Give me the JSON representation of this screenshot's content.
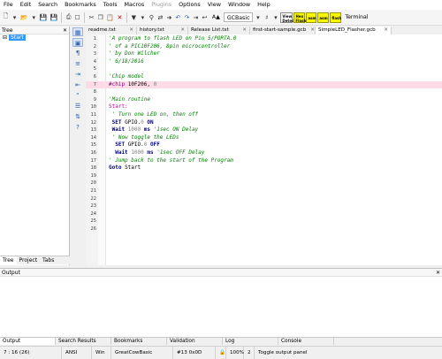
{
  "menu": [
    "File",
    "Edit",
    "Search",
    "Bookmarks",
    "Tools",
    "Macros",
    "Plugins",
    "Options",
    "View",
    "Window",
    "Help"
  ],
  "menu_disabled": "Plugins",
  "toolbar": {
    "language": "GCBasic",
    "label_view_detect": "View Detect",
    "label_hex_flash": "Hex Flash",
    "label_asm": "asm",
    "label_asm2": "asm",
    "label_flash": "flash",
    "terminal": "Terminal",
    "font_size": "A▲"
  },
  "tree": {
    "title": "Tree",
    "node": "Start",
    "tabs": [
      "Tree",
      "Project",
      "Tabs"
    ]
  },
  "doc_tabs": [
    {
      "label": "readme.txt",
      "active": false
    },
    {
      "label": "history.txt",
      "active": false
    },
    {
      "label": "Release List.txt",
      "active": false
    },
    {
      "label": "first-start-sample.gcb",
      "active": false
    },
    {
      "label": "SimpleLED_Flasher.gcb",
      "active": true
    }
  ],
  "code_lines": [
    {
      "n": "1",
      "segs": [
        {
          "t": "'A program to flash LED on Pin 5/PORTA.0",
          "c": "c-cmt"
        }
      ]
    },
    {
      "n": "2",
      "segs": [
        {
          "t": "' of a PIC10F206, 8pin microcontroller",
          "c": "c-cmt"
        }
      ]
    },
    {
      "n": "3",
      "segs": [
        {
          "t": "' by Don Wilcher",
          "c": "c-cmt"
        }
      ]
    },
    {
      "n": "4",
      "segs": [
        {
          "t": "' 6/18/2016",
          "c": "c-cmt"
        }
      ]
    },
    {
      "n": "5",
      "segs": []
    },
    {
      "n": "6",
      "segs": [
        {
          "t": "'Chip model",
          "c": "c-cmt"
        }
      ]
    },
    {
      "n": "7",
      "hl": true,
      "segs": [
        {
          "t": "#chip ",
          "c": "c-dir"
        },
        {
          "t": "10F206",
          "c": "c-plain"
        },
        {
          "t": ", ",
          "c": "c-plain"
        },
        {
          "t": "0",
          "c": "c-num"
        }
      ]
    },
    {
      "n": "8",
      "segs": []
    },
    {
      "n": "9",
      "segs": [
        {
          "t": "'Main routine",
          "c": "c-cmt"
        }
      ]
    },
    {
      "n": "10",
      "segs": [
        {
          "t": "Start:",
          "c": "c-label"
        }
      ]
    },
    {
      "n": "11",
      "segs": [
        {
          "t": " ' Turn one LED on, then off",
          "c": "c-cmt"
        }
      ]
    },
    {
      "n": "12",
      "segs": [
        {
          "t": " SET ",
          "c": "c-kw"
        },
        {
          "t": "GPIO.",
          "c": "c-plain"
        },
        {
          "t": "0",
          "c": "c-num"
        },
        {
          "t": " ON",
          "c": "c-kw"
        }
      ]
    },
    {
      "n": "13",
      "segs": [
        {
          "t": " Wait ",
          "c": "c-kw"
        },
        {
          "t": "1000",
          "c": "c-num"
        },
        {
          "t": " ms ",
          "c": "c-kw"
        },
        {
          "t": "'1sec ON Delay",
          "c": "c-cmt"
        }
      ]
    },
    {
      "n": "14",
      "segs": [
        {
          "t": " ' Now toggle the LEDs",
          "c": "c-cmt"
        }
      ]
    },
    {
      "n": "15",
      "segs": [
        {
          "t": "  SET ",
          "c": "c-kw"
        },
        {
          "t": "GPIO.",
          "c": "c-plain"
        },
        {
          "t": "0",
          "c": "c-num"
        },
        {
          "t": " OFF",
          "c": "c-kw"
        }
      ]
    },
    {
      "n": "16",
      "segs": [
        {
          "t": "  Wait ",
          "c": "c-kw"
        },
        {
          "t": "1000",
          "c": "c-num"
        },
        {
          "t": " ms ",
          "c": "c-kw"
        },
        {
          "t": "'1sec OFF Delay",
          "c": "c-cmt"
        }
      ]
    },
    {
      "n": "17",
      "segs": [
        {
          "t": "' Jump back to the start of the Program",
          "c": "c-cmt"
        }
      ]
    },
    {
      "n": "18",
      "segs": [
        {
          "t": "Goto ",
          "c": "c-kw"
        },
        {
          "t": "Start",
          "c": "c-plain"
        }
      ]
    },
    {
      "n": "19",
      "segs": []
    },
    {
      "n": "20",
      "segs": []
    },
    {
      "n": "21",
      "segs": []
    },
    {
      "n": "22",
      "segs": []
    },
    {
      "n": "23",
      "segs": []
    },
    {
      "n": "24",
      "segs": []
    },
    {
      "n": "25",
      "segs": []
    },
    {
      "n": "26",
      "segs": []
    }
  ],
  "output": {
    "title": "Output"
  },
  "bottom_tabs": [
    "Output",
    "Search Results",
    "Bookmarks",
    "Validation",
    "Log",
    "Console"
  ],
  "status": {
    "position": "7 : 16 (26)",
    "encoding": "ANSI",
    "eol": "Win",
    "language": "GreatCowBasic",
    "char": "#13 0x0D",
    "zoom": "100%",
    "panel_count": "2",
    "hint": "Toggle output panel"
  },
  "colors": {
    "highlight_line": "#ffdbe8",
    "selection": "#3399ff",
    "comment": "#008000"
  }
}
